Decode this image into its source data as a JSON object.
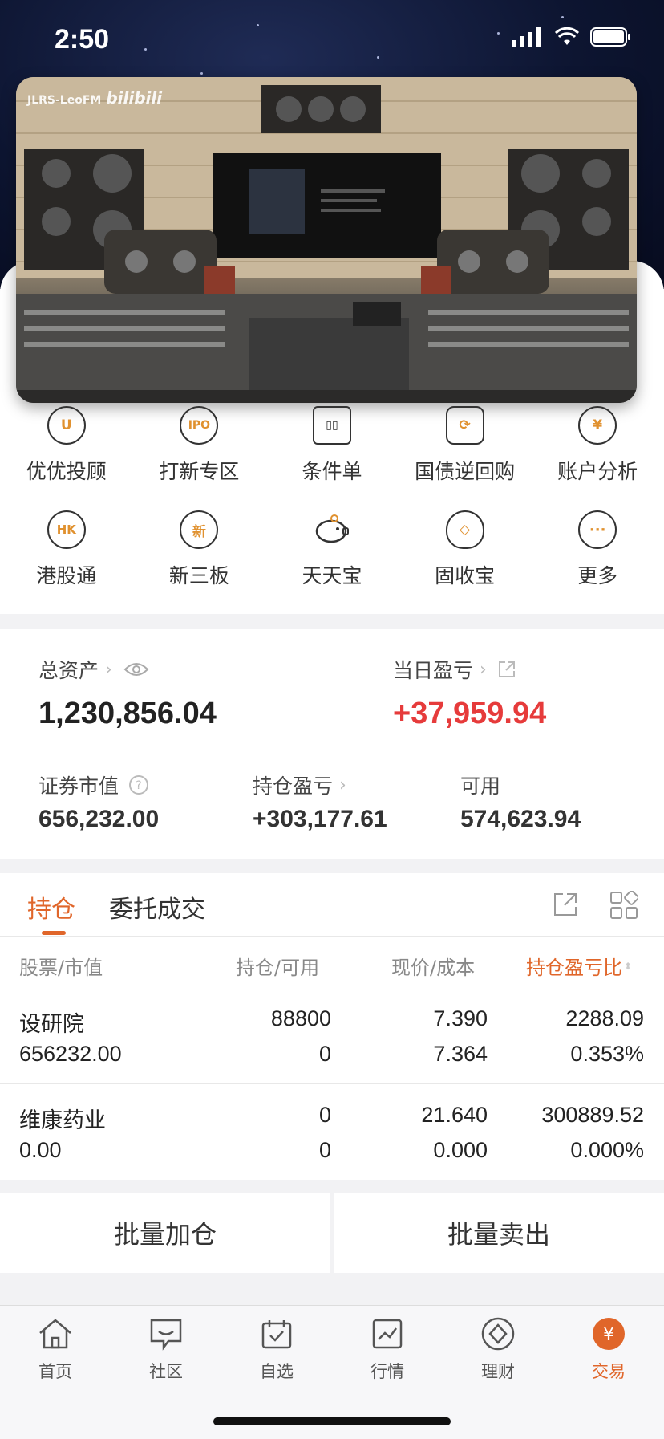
{
  "status_bar": {
    "time": "2:50"
  },
  "video": {
    "watermark_text": "JLRS-LeoFM",
    "watermark_brand": "bilibili"
  },
  "quick_menu": {
    "row1": [
      {
        "label": "优优投顾",
        "icon": "youyou-icon",
        "glyph": "U"
      },
      {
        "label": "打新专区",
        "icon": "ipo-icon",
        "glyph": "IPO"
      },
      {
        "label": "条件单",
        "icon": "condition-order-icon",
        "glyph": "▯▯"
      },
      {
        "label": "国债逆回购",
        "icon": "repo-icon",
        "glyph": "⟳"
      },
      {
        "label": "账户分析",
        "icon": "account-analysis-icon",
        "glyph": "¥"
      }
    ],
    "row2": [
      {
        "label": "港股通",
        "icon": "hk-icon",
        "glyph": "HK"
      },
      {
        "label": "新三板",
        "icon": "new-third-board-icon",
        "glyph": "新"
      },
      {
        "label": "天天宝",
        "icon": "piggy-bank-icon",
        "glyph": "🐖"
      },
      {
        "label": "固收宝",
        "icon": "money-bag-icon",
        "glyph": "◇"
      },
      {
        "label": "更多",
        "icon": "more-icon",
        "glyph": "···"
      }
    ]
  },
  "assets": {
    "total_label": "总资产",
    "total_value": "1,230,856.04",
    "daily_pl_label": "当日盈亏",
    "daily_pl_value": "+37,959.94",
    "market_value_label": "证券市值",
    "market_value": "656,232.00",
    "position_pl_label": "持仓盈亏",
    "position_pl_value": "+303,177.61",
    "available_label": "可用",
    "available_value": "574,623.94"
  },
  "positions": {
    "tabs": [
      "持仓",
      "委托成交"
    ],
    "headers": {
      "col1": "股票/市值",
      "col2": "持仓/可用",
      "col3": "现价/成本",
      "col4": "持仓盈亏比"
    },
    "rows": [
      {
        "name": "设研院",
        "market_value": "656232.00",
        "holding": "88800",
        "available": "0",
        "price": "7.390",
        "cost": "7.364",
        "pl": "2288.09",
        "pl_ratio": "0.353%"
      },
      {
        "name": "维康药业",
        "market_value": "0.00",
        "holding": "0",
        "available": "0",
        "price": "21.640",
        "cost": "0.000",
        "pl": "300889.52",
        "pl_ratio": "0.000%"
      }
    ]
  },
  "batch": {
    "add": "批量加仓",
    "sell": "批量卖出"
  },
  "bottom_nav": [
    {
      "label": "首页",
      "icon": "home-icon"
    },
    {
      "label": "社区",
      "icon": "community-icon"
    },
    {
      "label": "自选",
      "icon": "watchlist-icon"
    },
    {
      "label": "行情",
      "icon": "market-icon"
    },
    {
      "label": "理财",
      "icon": "wealth-icon"
    },
    {
      "label": "交易",
      "icon": "trade-icon",
      "active": true
    }
  ],
  "colors": {
    "accent": "#e0662a",
    "red": "#e63b3b"
  }
}
